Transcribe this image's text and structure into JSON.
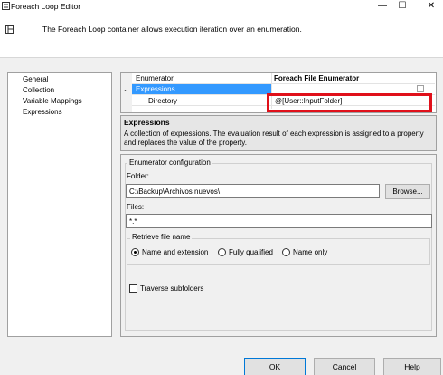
{
  "window": {
    "title": "Foreach Loop Editor",
    "minimize": "—",
    "maximize": "☐",
    "close": "✕"
  },
  "header": {
    "description": "The Foreach Loop container allows execution iteration over an enumeration."
  },
  "nav": {
    "items": [
      {
        "label": "General"
      },
      {
        "label": "Collection"
      },
      {
        "label": "Variable Mappings"
      },
      {
        "label": "Expressions"
      }
    ]
  },
  "property_grid": {
    "rows": [
      {
        "name": "Enumerator",
        "value": "Foreach File Enumerator"
      },
      {
        "name": "Expressions",
        "value": ""
      },
      {
        "name": "Directory",
        "value": "@[User::InputFolder]"
      }
    ]
  },
  "description": {
    "title": "Expressions",
    "text": "A collection of expressions. The evaluation result of each expression is assigned to a property and replaces the value of the property."
  },
  "config": {
    "group_label": "Enumerator configuration",
    "folder_label": "Folder:",
    "folder_value": "C:\\Backup\\Archivos nuevos\\",
    "browse_label": "Browse...",
    "files_label": "Files:",
    "files_value": "*.*",
    "retrieve_label": "Retrieve file name",
    "radio_options": [
      {
        "label": "Name and extension",
        "selected": true
      },
      {
        "label": "Fully qualified",
        "selected": false
      },
      {
        "label": "Name only",
        "selected": false
      }
    ],
    "traverse_label": "Traverse subfolders",
    "traverse_checked": false
  },
  "buttons": {
    "ok": "OK",
    "cancel": "Cancel",
    "help": "Help"
  },
  "colors": {
    "selection": "#3399ff",
    "highlight_border": "#e0101a"
  }
}
